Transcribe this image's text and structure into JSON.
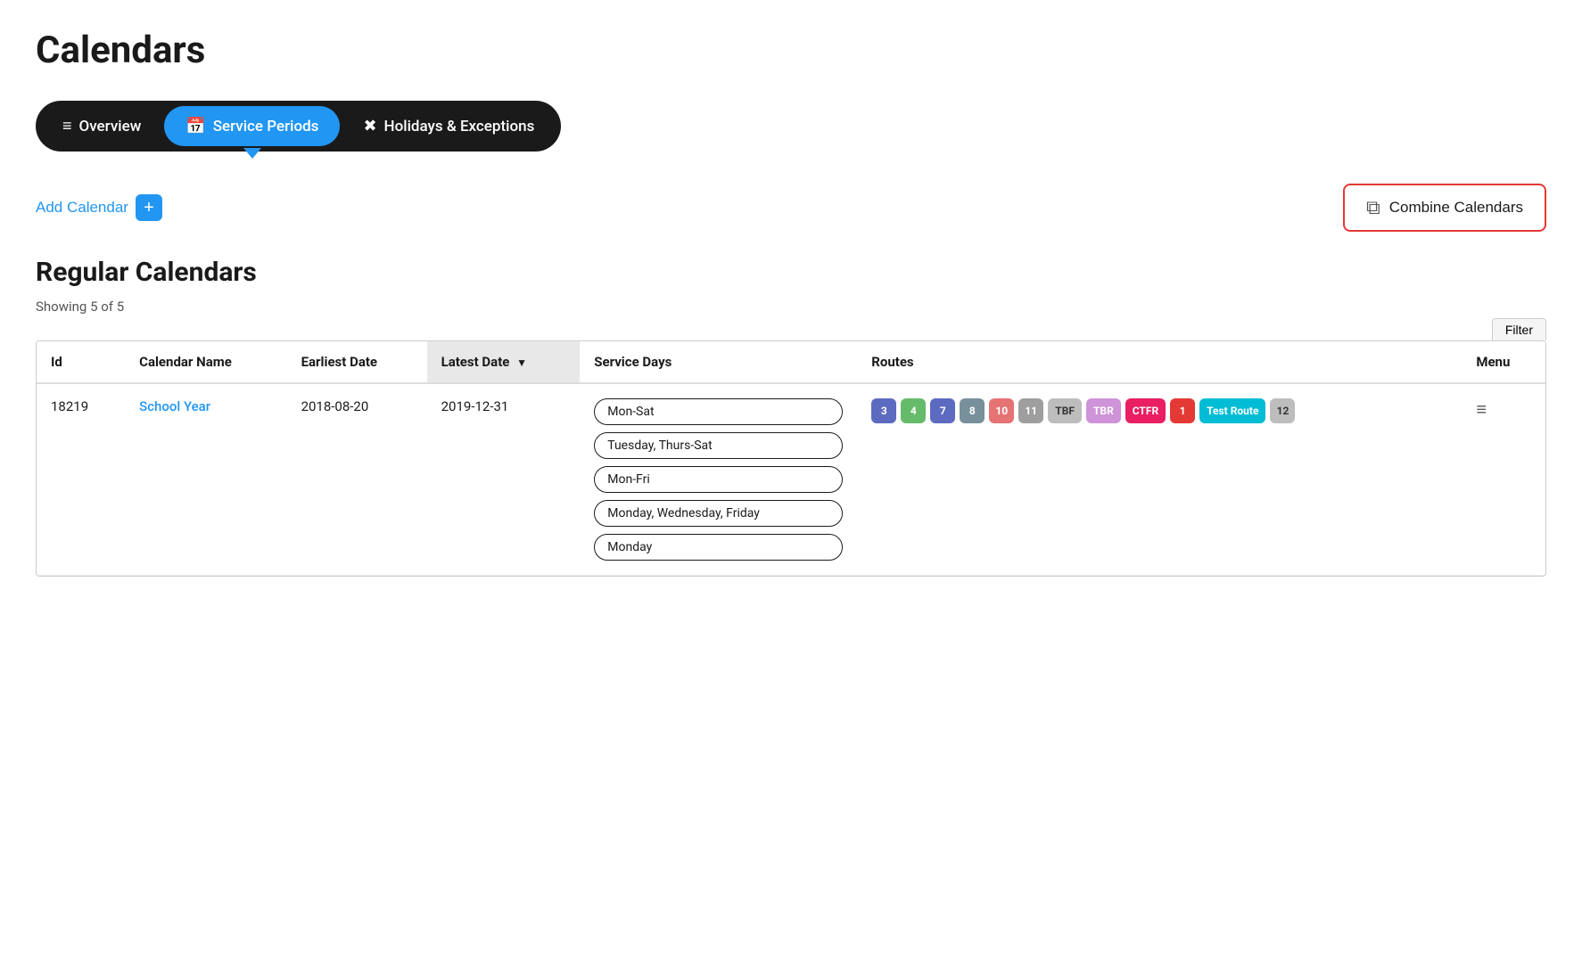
{
  "page": {
    "title": "Calendars"
  },
  "tabs": [
    {
      "id": "overview",
      "label": "Overview",
      "icon": "≡▪",
      "active": false
    },
    {
      "id": "service-periods",
      "label": "Service Periods",
      "icon": "📅",
      "active": true
    },
    {
      "id": "holidays-exceptions",
      "label": "Holidays & Exceptions",
      "icon": "✖",
      "active": false
    }
  ],
  "actions": {
    "add_calendar_label": "Add Calendar",
    "combine_calendars_label": "Combine Calendars"
  },
  "section": {
    "title": "Regular Calendars",
    "showing": "Showing 5 of 5",
    "filter_label": "Filter"
  },
  "table": {
    "columns": [
      {
        "id": "id",
        "label": "Id"
      },
      {
        "id": "calendar-name",
        "label": "Calendar Name"
      },
      {
        "id": "earliest-date",
        "label": "Earliest Date"
      },
      {
        "id": "latest-date",
        "label": "Latest Date",
        "sorted": true,
        "sortDir": "desc"
      },
      {
        "id": "service-days",
        "label": "Service Days"
      },
      {
        "id": "routes",
        "label": "Routes"
      },
      {
        "id": "menu",
        "label": "Menu"
      }
    ],
    "rows": [
      {
        "id": "18219",
        "calendar_name": "School Year",
        "earliest_date": "2018-08-20",
        "latest_date": "2019-12-31",
        "service_days": [
          "Mon-Sat",
          "Tuesday, Thurs-Sat",
          "Mon-Fri",
          "Monday, Wednesday, Friday",
          "Monday"
        ],
        "routes": [
          {
            "label": "3",
            "color": "#5c6bc0"
          },
          {
            "label": "4",
            "color": "#66bb6a"
          },
          {
            "label": "7",
            "color": "#5c6bc0"
          },
          {
            "label": "8",
            "color": "#78909c"
          },
          {
            "label": "10",
            "color": "#e57373"
          },
          {
            "label": "11",
            "color": "#9e9e9e"
          },
          {
            "label": "TBF",
            "color": "#bdbdbd",
            "text": true
          },
          {
            "label": "TBR",
            "color": "#ce93d8",
            "text": true
          },
          {
            "label": "CTFR",
            "color": "#e91e63",
            "text": true
          },
          {
            "label": "1",
            "color": "#e53935"
          },
          {
            "label": "Test Route",
            "color": "#00bcd4",
            "text": true
          },
          {
            "label": "12",
            "color": "#bdbdbd"
          }
        ]
      }
    ]
  }
}
